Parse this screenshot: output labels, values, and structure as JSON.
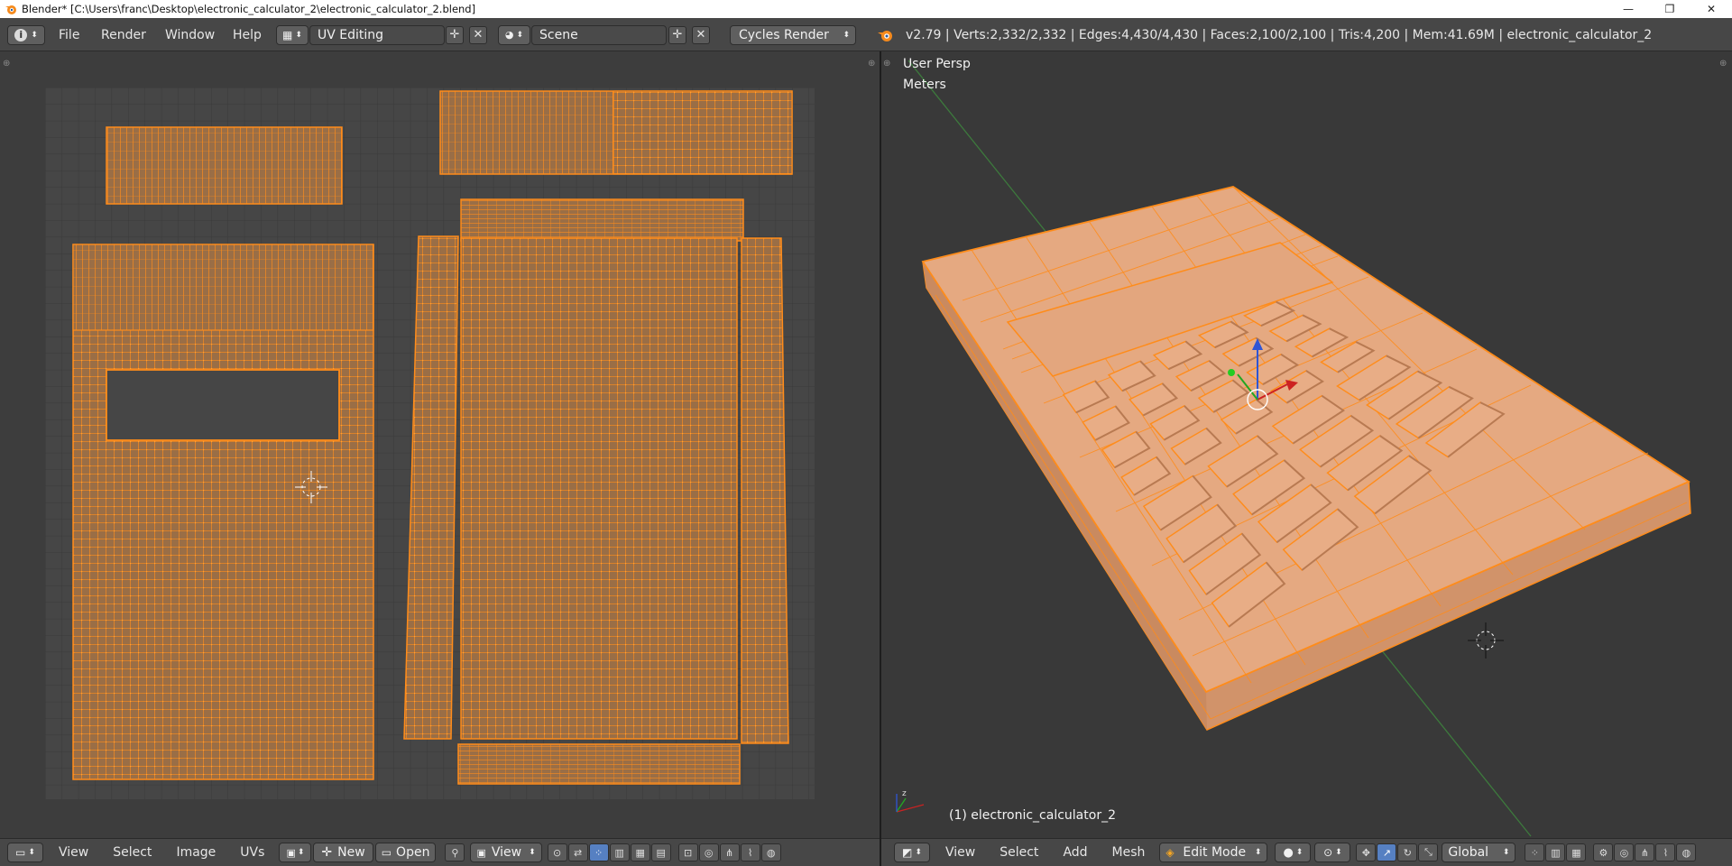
{
  "window": {
    "title": "Blender* [C:\\Users\\franc\\Desktop\\electronic_calculator_2\\electronic_calculator_2.blend]",
    "controls": [
      "—",
      "❐",
      "✕"
    ]
  },
  "info_header": {
    "menus": [
      "File",
      "Render",
      "Window",
      "Help"
    ],
    "screen_layout": "UV Editing",
    "scene": "Scene",
    "render_engine": "Cycles Render",
    "stats": "v2.79 | Verts:2,332/2,332 | Edges:4,430/4,430 | Faces:2,100/2,100 | Tris:4,200 | Mem:41.69M | electronic_calculator_2"
  },
  "viewport": {
    "view_name": "User Persp",
    "units": "Meters",
    "object_label": "(1) electronic_calculator_2"
  },
  "uv_header": {
    "menus": [
      "View",
      "Select",
      "Image",
      "UVs"
    ],
    "new_label": "New",
    "open_label": "Open",
    "view_label": "View"
  },
  "v3d_header": {
    "menus": [
      "View",
      "Select",
      "Add",
      "Mesh"
    ],
    "mode": "Edit Mode",
    "orientation": "Global"
  },
  "colors": {
    "header_bg": "#474747",
    "uv_bg": "#3d3d3d",
    "viewport_bg": "#393939",
    "wire_orange": "#ff8c1a",
    "face_orange": "#a0734a",
    "model_face": "#e2a57a",
    "accent_blue": "#5680c2"
  }
}
